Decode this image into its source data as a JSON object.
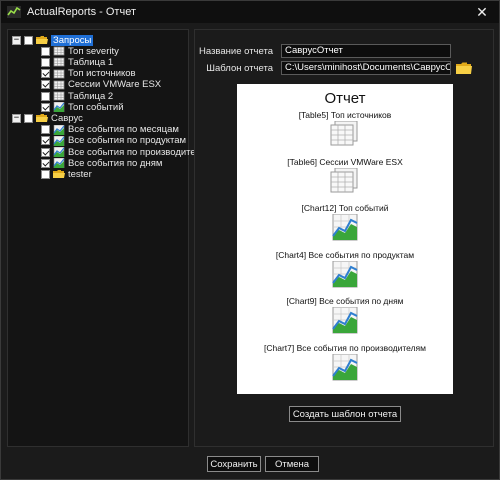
{
  "window": {
    "title": "ActualReports - Отчет",
    "app_icon": "actualreports-app-icon",
    "close_label": "✕"
  },
  "tree": {
    "groups": [
      {
        "label": "Запросы",
        "expander": "−",
        "checked": false,
        "selected": true,
        "items": [
          {
            "label": "Топ severity",
            "checked": false,
            "icon": "table-icon"
          },
          {
            "label": "Таблица 1",
            "checked": false,
            "icon": "table-icon"
          },
          {
            "label": "Топ источников",
            "checked": true,
            "icon": "table-icon"
          },
          {
            "label": "Сессии VMWare ESX",
            "checked": true,
            "icon": "table-icon"
          },
          {
            "label": "Таблица 2",
            "checked": false,
            "icon": "table-icon"
          },
          {
            "label": "Топ событий",
            "checked": true,
            "icon": "chart-icon"
          }
        ]
      },
      {
        "label": "Саврус",
        "expander": "−",
        "checked": false,
        "selected": false,
        "items": [
          {
            "label": "Все события по месяцам",
            "checked": false,
            "icon": "chart-icon"
          },
          {
            "label": "Все события по продуктам",
            "checked": true,
            "icon": "chart-icon"
          },
          {
            "label": "Все события по производителям",
            "checked": true,
            "icon": "chart-icon"
          },
          {
            "label": "Все события по дням",
            "checked": true,
            "icon": "chart-icon"
          },
          {
            "label": "tester",
            "checked": false,
            "icon": "folder-icon"
          }
        ]
      }
    ]
  },
  "form": {
    "report_name_label": "Название отчета",
    "report_name_value": "СаврусОтчет",
    "template_label": "Шаблон отчета",
    "template_value": "C:\\Users\\minihost\\Documents\\СаврусОтчет.doc"
  },
  "preview": {
    "title": "Отчет",
    "items": [
      {
        "label": "[Table5] Топ источников",
        "icon": "table-icon"
      },
      {
        "label": "[Table6] Сессии VMWare ESX",
        "icon": "table-icon"
      },
      {
        "label": "[Chart12] Топ событий",
        "icon": "chart-icon"
      },
      {
        "label": "[Chart4] Все события по продуктам",
        "icon": "chart-icon"
      },
      {
        "label": "[Chart9] Все события по дням",
        "icon": "chart-icon"
      },
      {
        "label": "[Chart7] Все события по производителям",
        "icon": "chart-icon"
      }
    ]
  },
  "buttons": {
    "create_template": "Создать шаблон отчета",
    "save": "Сохранить",
    "cancel": "Отмена"
  },
  "colors": {
    "selection": "#1f6fd6",
    "folder": "#f2c12e",
    "chart_green": "#3aa63a",
    "chart_blue": "#2f7fd0"
  }
}
